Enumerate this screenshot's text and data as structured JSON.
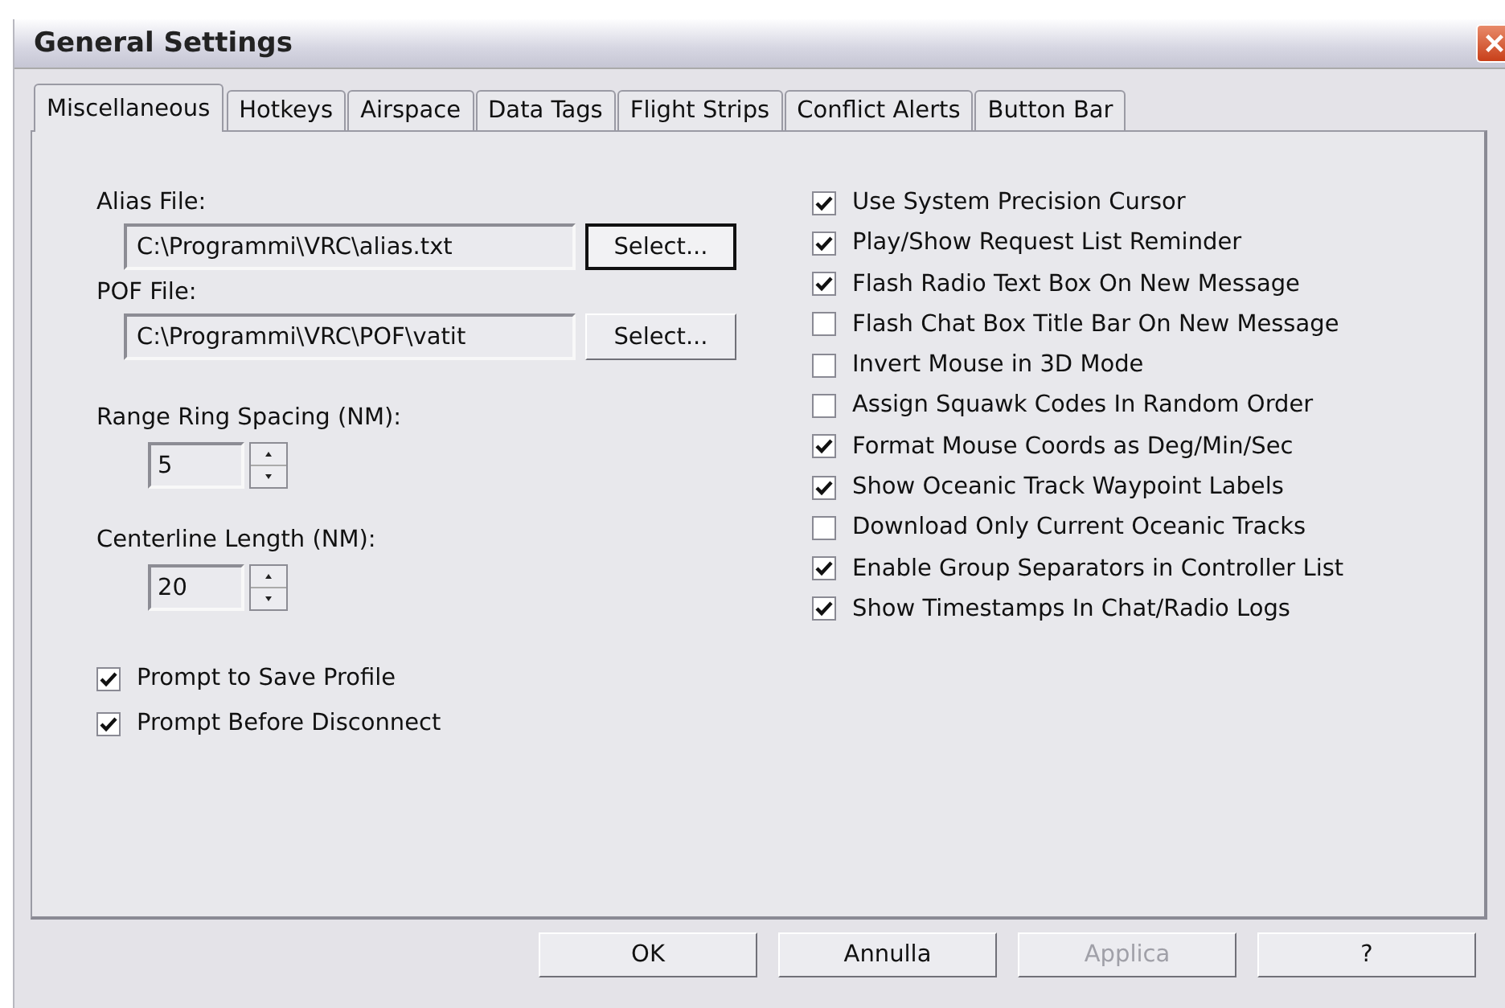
{
  "window": {
    "title": "General Settings"
  },
  "tabs": [
    {
      "label": "Miscellaneous",
      "selected": true
    },
    {
      "label": "Hotkeys",
      "selected": false
    },
    {
      "label": "Airspace",
      "selected": false
    },
    {
      "label": "Data Tags",
      "selected": false
    },
    {
      "label": "Flight Strips",
      "selected": false
    },
    {
      "label": "Conflict Alerts",
      "selected": false
    },
    {
      "label": "Button Bar",
      "selected": false
    }
  ],
  "files": [
    {
      "label": "Alias File:",
      "value": "C:\\Programmi\\VRC\\alias.txt",
      "button": "Select...",
      "focused": true
    },
    {
      "label": "POF File:",
      "value": "C:\\Programmi\\VRC\\POF\\vatit",
      "button": "Select...",
      "focused": false
    }
  ],
  "spinners": [
    {
      "label": "Range Ring Spacing (NM):",
      "value": "5"
    },
    {
      "label": "Centerline Length (NM):",
      "value": "20"
    }
  ],
  "left_options": [
    {
      "label": "Prompt to Save Profile",
      "checked": true
    },
    {
      "label": "Prompt Before Disconnect",
      "checked": true
    }
  ],
  "right_options": [
    {
      "label": "Use System Precision Cursor",
      "checked": true
    },
    {
      "label": "Play/Show Request List Reminder",
      "checked": true
    },
    {
      "label": "Flash Radio Text Box On New Message",
      "checked": true
    },
    {
      "label": "Flash Chat Box Title Bar On New Message",
      "checked": false
    },
    {
      "label": "Invert Mouse in 3D Mode",
      "checked": false
    },
    {
      "label": "Assign Squawk Codes In Random Order",
      "checked": false
    },
    {
      "label": "Format Mouse Coords as Deg/Min/Sec",
      "checked": true
    },
    {
      "label": "Show Oceanic Track Waypoint Labels",
      "checked": true
    },
    {
      "label": "Download Only Current Oceanic Tracks",
      "checked": false
    },
    {
      "label": "Enable Group Separators in Controller List",
      "checked": true
    },
    {
      "label": "Show Timestamps In Chat/Radio Logs",
      "checked": true
    }
  ],
  "buttons": [
    {
      "label": "OK",
      "disabled": false
    },
    {
      "label": "Annulla",
      "disabled": false
    },
    {
      "label": "Applica",
      "disabled": true
    },
    {
      "label": "?",
      "disabled": false
    }
  ]
}
